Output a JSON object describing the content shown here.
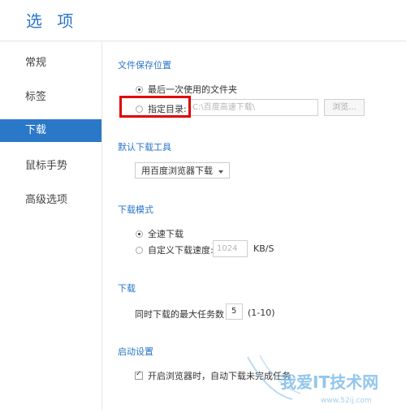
{
  "header": {
    "title": "选 项"
  },
  "sidebar": {
    "items": [
      {
        "label": "常规"
      },
      {
        "label": "标签"
      },
      {
        "label": "下载"
      },
      {
        "label": "鼠标手势"
      },
      {
        "label": "高级选项"
      }
    ]
  },
  "save_location": {
    "title": "文件保存位置",
    "last_used_label": "最后一次使用的文件夹",
    "specified_label": "指定目录:",
    "path_value": "C:\\百度高速下载\\",
    "browse_label": "浏览..."
  },
  "default_tool": {
    "title": "默认下载工具",
    "selected": "用百度浏览器下载"
  },
  "download_mode": {
    "title": "下载模式",
    "full_speed_label": "全速下载",
    "custom_speed_label": "自定义下载速度:",
    "speed_value": "1024",
    "speed_unit": "KB/S"
  },
  "download_tasks": {
    "title": "下载",
    "max_tasks_label": "同时下载的最大任务数",
    "max_tasks_value": "5",
    "range_label": "(1-10)"
  },
  "startup": {
    "title": "启动设置",
    "resume_label": "开启浏览器时，自动下载未完成任务"
  },
  "watermark": {
    "text": "我爱IT技术网",
    "url": "www.52ij.com"
  },
  "colors": {
    "accent": "#2b78c9",
    "highlight_border": "#e00000"
  }
}
